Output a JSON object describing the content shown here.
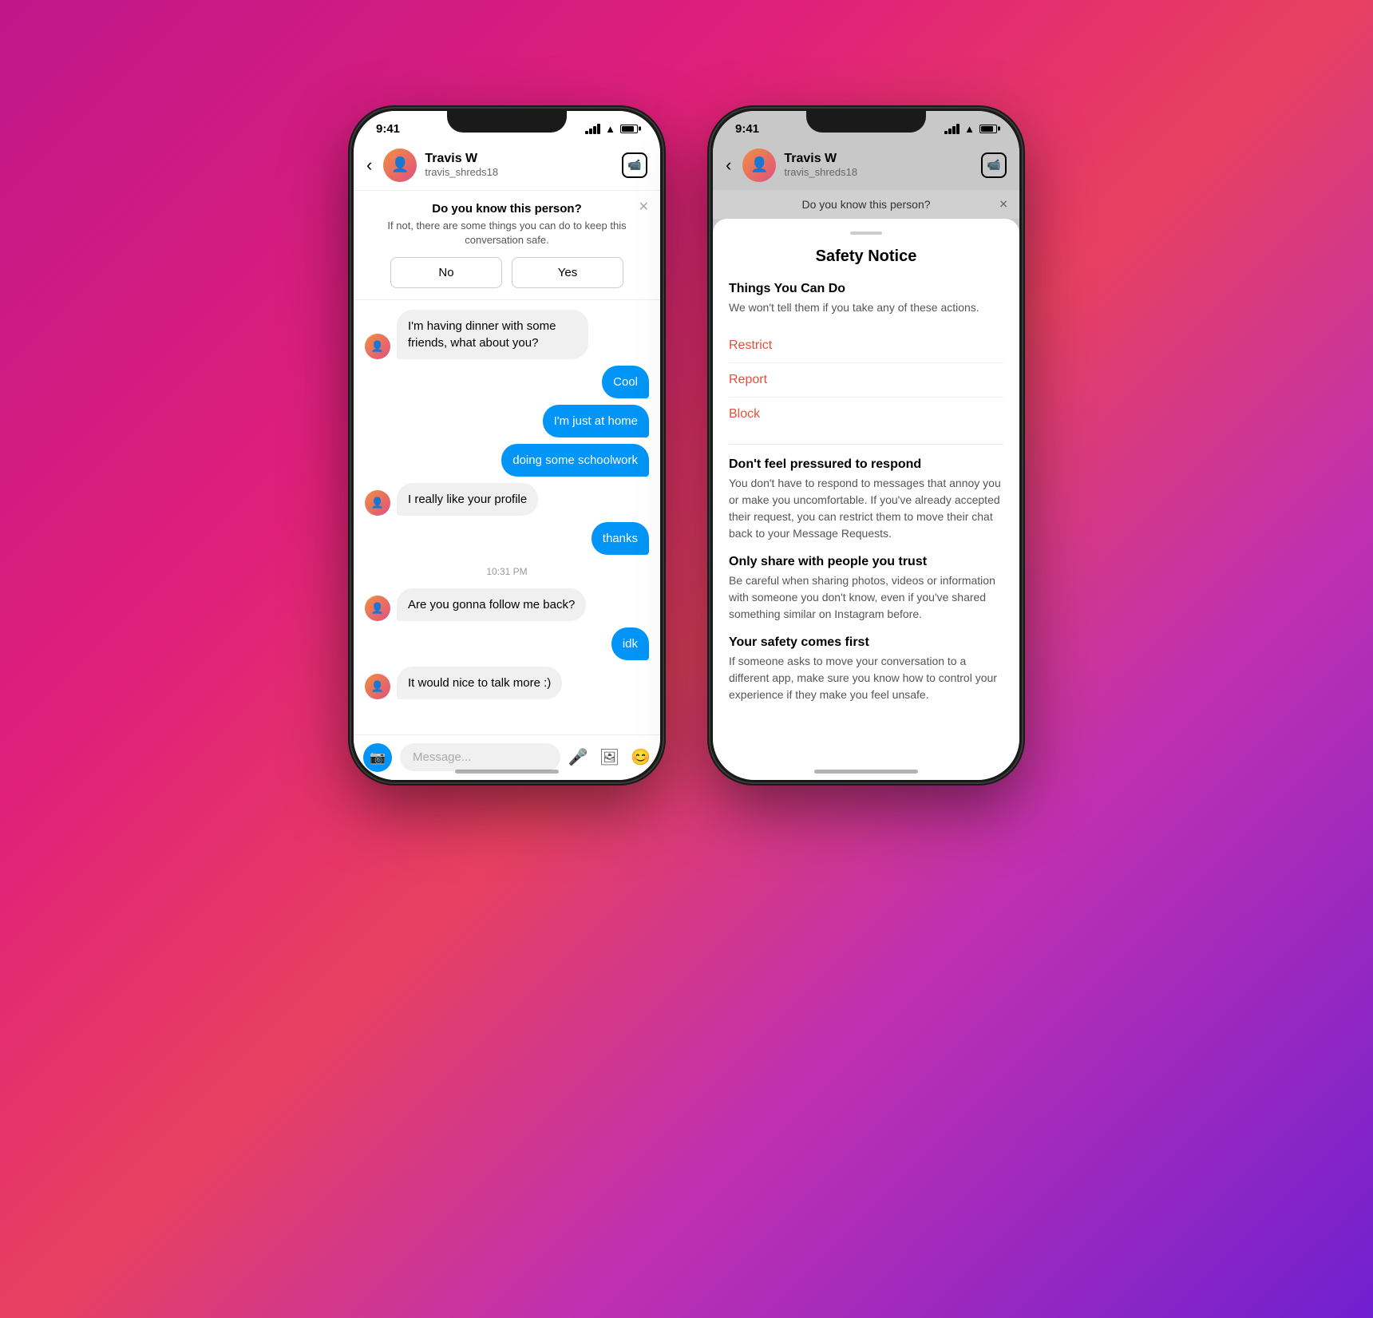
{
  "background": {
    "gradient": "linear-gradient(135deg, #c0168a, #e84060, #7020d0)"
  },
  "leftPhone": {
    "statusBar": {
      "time": "9:41"
    },
    "header": {
      "name": "Travis W",
      "username": "travis_shreds18"
    },
    "safetyBanner": {
      "title": "Do you know this person?",
      "description": "If not, there are some things you can do to keep this conversation safe.",
      "noLabel": "No",
      "yesLabel": "Yes"
    },
    "messages": [
      {
        "type": "incoming",
        "text": "I'm having dinner with some friends, what about you?"
      },
      {
        "type": "outgoing",
        "text": "Cool"
      },
      {
        "type": "outgoing",
        "text": "I'm just at home"
      },
      {
        "type": "outgoing",
        "text": "doing some schoolwork"
      },
      {
        "type": "incoming",
        "text": "I really like your profile"
      },
      {
        "type": "outgoing",
        "text": "thanks"
      },
      {
        "type": "timestamp",
        "text": "10:31 PM"
      },
      {
        "type": "incoming",
        "text": "Are you gonna follow me back?"
      },
      {
        "type": "outgoing",
        "text": "idk"
      },
      {
        "type": "incoming",
        "text": "It would nice to talk more :)"
      }
    ],
    "inputPlaceholder": "Message..."
  },
  "rightPhone": {
    "statusBar": {
      "time": "9:41"
    },
    "header": {
      "name": "Travis W",
      "username": "travis_shreds18"
    },
    "doYouKnowBar": "Do you know this person?",
    "safetySheet": {
      "title": "Safety Notice",
      "thingsYouCanDo": {
        "title": "Things You Can Do",
        "description": "We won't tell them if you take any of these actions.",
        "actions": [
          "Restrict",
          "Report",
          "Block"
        ]
      },
      "sections": [
        {
          "title": "Don't feel pressured to respond",
          "text": "You don't have to respond to messages that annoy you or make you uncomfortable. If you've already accepted their request, you can restrict them to move their chat back to your Message Requests."
        },
        {
          "title": "Only share with people you trust",
          "text": "Be careful when sharing photos, videos or information with someone you don't know, even if you've shared something similar on Instagram before."
        },
        {
          "title": "Your safety comes first",
          "text": "If someone asks to move your conversation to a different app, make sure you know how to control your experience if they make you feel unsafe."
        }
      ]
    }
  }
}
